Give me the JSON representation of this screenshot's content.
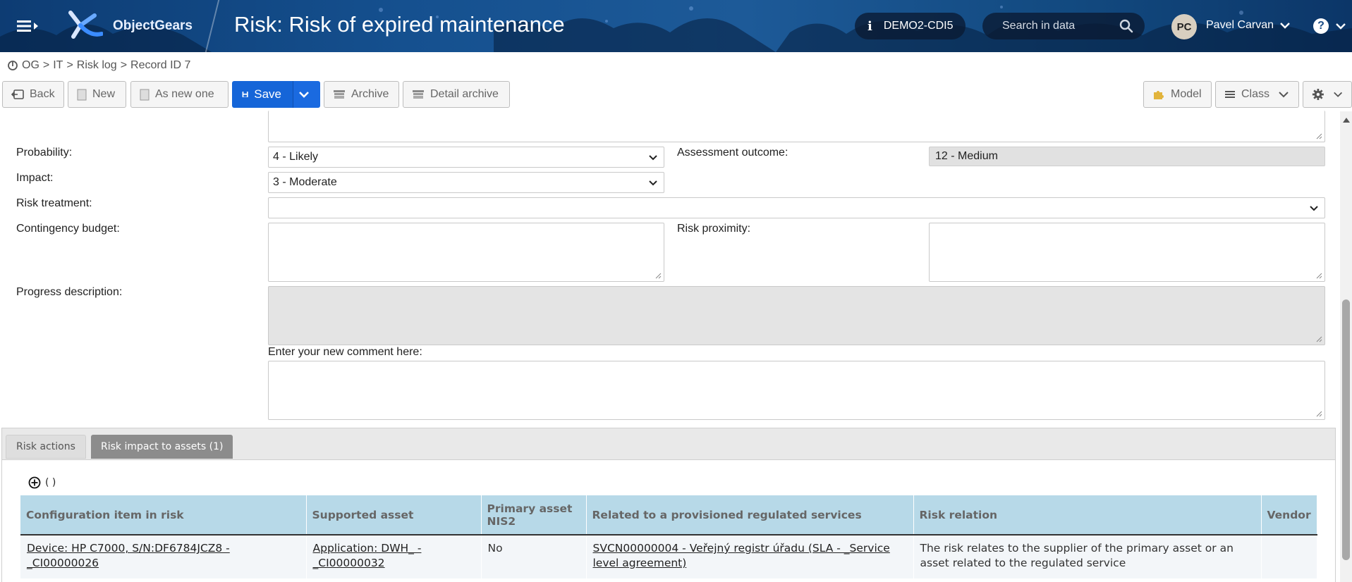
{
  "header": {
    "brand": "ObjectGears",
    "title": "Risk: Risk of expired maintenance",
    "environment": "DEMO2-CDI5",
    "search_placeholder": "Search in data",
    "user_initials": "PC",
    "user_name": "Pavel Carvan",
    "help_label": "?"
  },
  "breadcrumb": {
    "items": [
      "OG",
      ">",
      "IT",
      ">",
      "Risk log",
      ">",
      "Record ID 7"
    ]
  },
  "toolbar": {
    "back": "Back",
    "new": "New",
    "as_new_one": "As new one",
    "save": "Save",
    "archive": "Archive",
    "detail_archive": "Detail archive",
    "model": "Model",
    "class": "Class"
  },
  "form": {
    "probability_label": "Probability:",
    "probability_value": "4 - Likely",
    "impact_label": "Impact:",
    "impact_value": "3 - Moderate",
    "assessment_label": "Assessment outcome:",
    "assessment_value": "12 - Medium",
    "risk_treatment_label": "Risk treatment:",
    "risk_treatment_value": "",
    "contingency_label": "Contingency budget:",
    "risk_proximity_label": "Risk proximity:",
    "progress_label": "Progress description:",
    "comment_label": "Enter your new comment here:"
  },
  "tabs": [
    {
      "label": "Risk actions"
    },
    {
      "label": "Risk impact to assets (1)"
    }
  ],
  "grid": {
    "toolbar_text": "( )",
    "columns": [
      "Configuration item in risk",
      "Supported asset",
      "Primary asset NIS2",
      "Related to a provisioned regulated services",
      "Risk relation",
      "Vendor"
    ],
    "rows": [
      {
        "ci": "Device: HP C7000, S/N:DF6784JCZ8 - _CI00000026",
        "asset": "Application: DWH_ - _CI00000032",
        "primary": "No",
        "service": "SVCN00000004 - Veřejný registr úřadu (SLA - _Service level agreement)",
        "relation": "The risk relates to the supplier of the primary asset or an asset related to the regulated service",
        "vendor": ""
      }
    ]
  },
  "colors": {
    "banner": "#15508f",
    "save_button": "#1565d8",
    "grid_header": "#b7d9e8",
    "active_tab": "#8c8c8c"
  }
}
